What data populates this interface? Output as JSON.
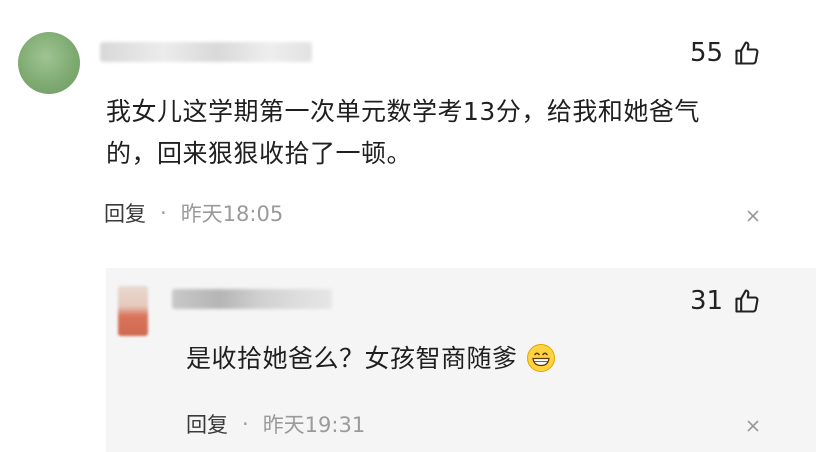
{
  "comment": {
    "likes": "55",
    "text_line1": "我女儿这学期第一次单元数学考13分，给我和她爸气",
    "text_line2": "的，回来狠狠收拾了一顿。",
    "reply_label": "回复",
    "separator": "·",
    "time": "昨天18:05"
  },
  "reply": {
    "likes": "31",
    "text": "是收拾她爸么？女孩智商随爹",
    "emoji": "grinning-face-icon",
    "reply_label": "回复",
    "separator": "·",
    "time": "昨天19:31"
  }
}
